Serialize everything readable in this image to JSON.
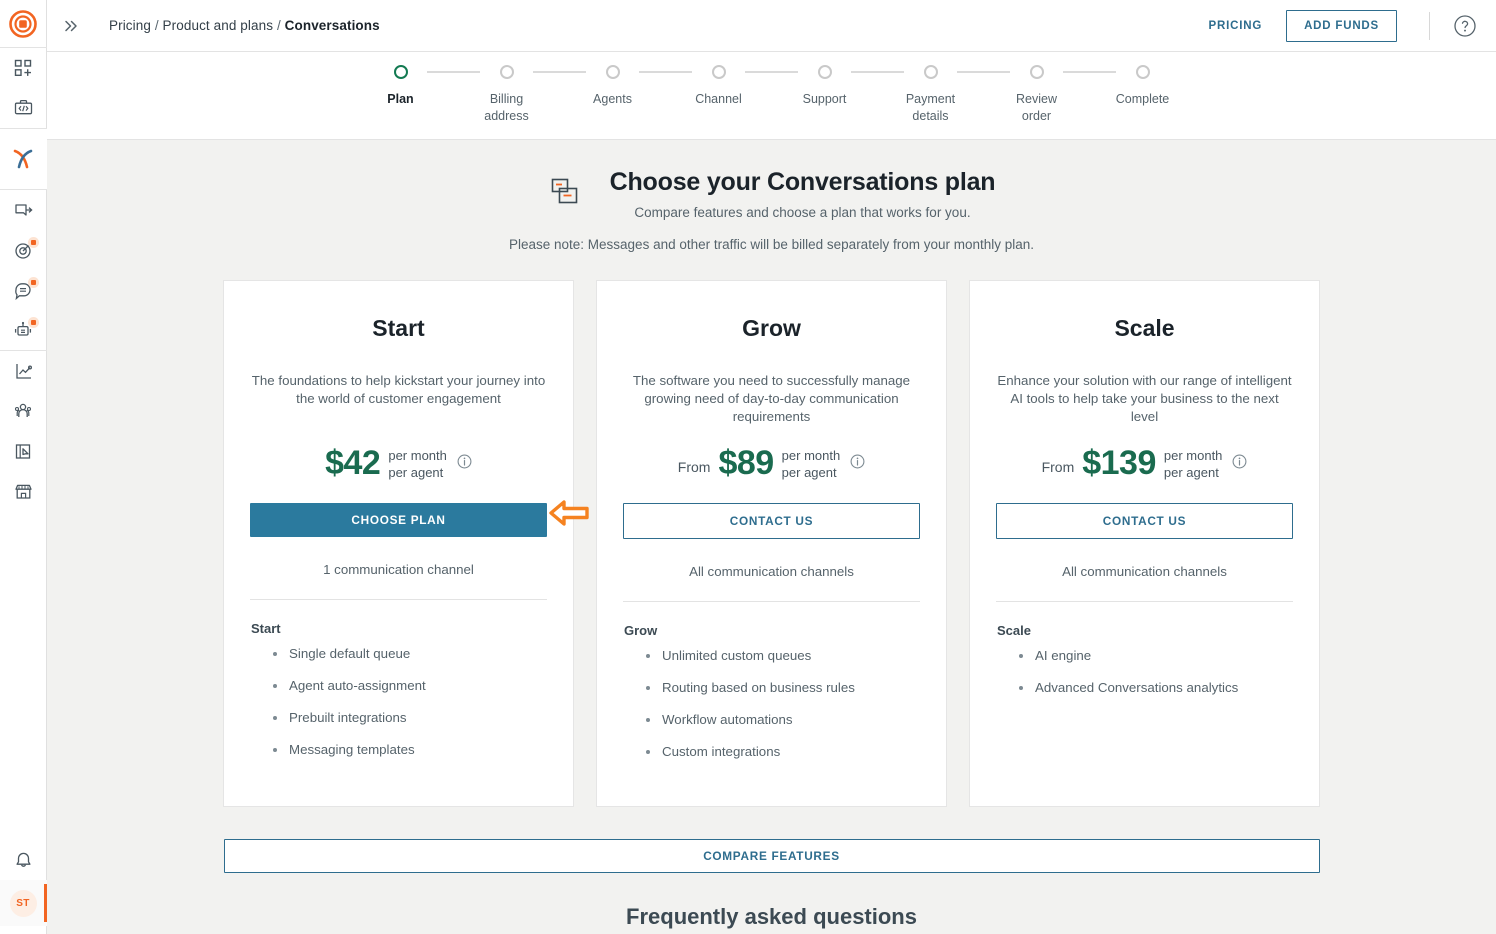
{
  "brand": {
    "logo_icon": "target-logo-icon",
    "accent": "#f26522",
    "link_color": "#2e6d8e",
    "price_color": "#1a6b4f",
    "cta_fill": "#2b7a9e"
  },
  "sidebar": {
    "items": [
      {
        "icon": "apps-add-icon",
        "badge": false
      },
      {
        "icon": "developer-toolbox-icon",
        "badge": false
      },
      {
        "icon": "conversations-x-icon",
        "badge": false,
        "active": true
      },
      {
        "icon": "campaign-send-icon",
        "badge": false
      },
      {
        "icon": "target-goals-icon",
        "badge": true
      },
      {
        "icon": "chat-message-icon",
        "badge": true
      },
      {
        "icon": "chatbot-robot-icon",
        "badge": true
      },
      {
        "icon": "analytics-line-icon",
        "badge": false
      },
      {
        "icon": "audience-people-icon",
        "badge": false
      },
      {
        "icon": "panel-cursor-icon",
        "badge": false
      },
      {
        "icon": "marketplace-store-icon",
        "badge": false
      }
    ],
    "notifications_icon": "bell-icon",
    "avatar_initials": "ST"
  },
  "header": {
    "expand_icon": "double-chevron-right-icon",
    "breadcrumb": {
      "root": "Pricing",
      "section": "Product and plans",
      "current": "Conversations",
      "separator": "/"
    },
    "pricing_link": "PRICING",
    "add_funds_button": "ADD FUNDS",
    "help_icon": "help-circle-icon"
  },
  "stepper": {
    "steps": [
      {
        "label": "Plan",
        "active": true
      },
      {
        "label": "Billing address",
        "active": false
      },
      {
        "label": "Agents",
        "active": false
      },
      {
        "label": "Channel",
        "active": false
      },
      {
        "label": "Support",
        "active": false
      },
      {
        "label": "Payment details",
        "active": false
      },
      {
        "label": "Review order",
        "active": false
      },
      {
        "label": "Complete",
        "active": false
      }
    ]
  },
  "page": {
    "icon": "conversations-bubbles-icon",
    "title": "Choose your Conversations plan",
    "subtitle": "Compare features and choose a plan that works for you.",
    "note": "Please note: Messages and other traffic will be billed separately from your monthly plan."
  },
  "plans": [
    {
      "name": "Start",
      "description": "The foundations to help kickstart your journey into the world of customer engagement",
      "price_prefix": "",
      "price": "$42",
      "unit_line1": "per month",
      "unit_line2": "per agent",
      "info_icon": "info-circle-icon",
      "cta_label": "CHOOSE PLAN",
      "cta_style": "filled",
      "channels": "1 communication channel",
      "features_title": "Start",
      "features": [
        "Single default queue",
        "Agent auto-assignment",
        "Prebuilt integrations",
        "Messaging templates"
      ]
    },
    {
      "name": "Grow",
      "description": "The software you need to successfully manage growing need of day-to-day communication requirements",
      "price_prefix": "From",
      "price": "$89",
      "unit_line1": "per month",
      "unit_line2": "per agent",
      "info_icon": "info-circle-icon",
      "cta_label": "CONTACT US",
      "cta_style": "outline",
      "channels": "All communication channels",
      "features_title": "Grow",
      "features": [
        "Unlimited custom queues",
        "Routing based on business rules",
        "Workflow automations",
        "Custom integrations"
      ]
    },
    {
      "name": "Scale",
      "description": "Enhance your solution with our range of intelligent AI tools to help take your business to the next level",
      "price_prefix": "From",
      "price": "$139",
      "unit_line1": "per month",
      "unit_line2": "per agent",
      "info_icon": "info-circle-icon",
      "cta_label": "CONTACT US",
      "cta_style": "outline",
      "channels": "All communication channels",
      "features_title": "Scale",
      "features": [
        "AI engine",
        "Advanced Conversations analytics"
      ]
    }
  ],
  "compare_button": "COMPARE FEATURES",
  "faq_title": "Frequently asked questions",
  "annotation": {
    "icon": "left-arrow-annotation",
    "color": "#f58220",
    "points_to": "CHOOSE PLAN"
  }
}
